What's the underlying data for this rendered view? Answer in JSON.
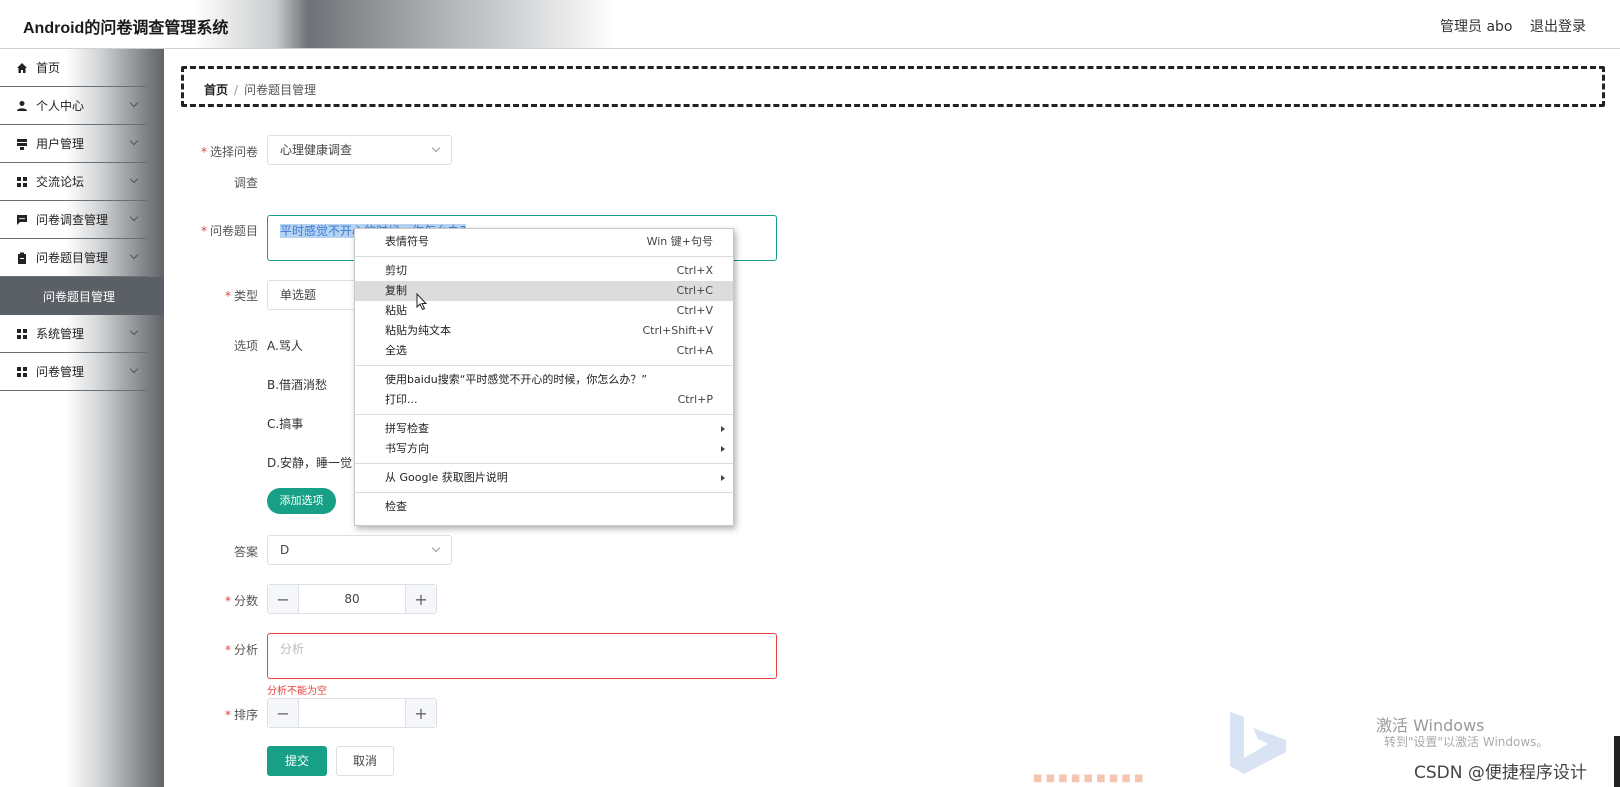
{
  "header": {
    "title": "Android的问卷调查管理系统",
    "user": "管理员 abo",
    "logout": "退出登录"
  },
  "sidebar": {
    "items": [
      {
        "label": "首页",
        "icon": "home-icon"
      },
      {
        "label": "个人中心",
        "icon": "user-icon"
      },
      {
        "label": "用户管理",
        "icon": "users-icon"
      },
      {
        "label": "交流论坛",
        "icon": "grid-icon"
      },
      {
        "label": "问卷调查管理",
        "icon": "chat-icon"
      },
      {
        "label": "问卷题目管理",
        "icon": "clipboard-icon"
      },
      {
        "label": "问卷题目管理"
      },
      {
        "label": "系统管理",
        "icon": "grid-icon"
      },
      {
        "label": "问卷管理",
        "icon": "grid-icon"
      }
    ]
  },
  "breadcrumb": {
    "home": "首页",
    "sep": "/",
    "current": "问卷题目管理"
  },
  "form": {
    "survey_label_1": "选择问卷",
    "survey_label_2": "调查",
    "survey_value": "心理健康调查",
    "question_label": "问卷题目",
    "question_value": "平时感觉不开心的时候，你怎么办?",
    "type_label": "类型",
    "type_value": "单选题",
    "options_label": "选项",
    "options": [
      "A.骂人",
      "B.借酒消愁",
      "C.搞事",
      "D.安静，睡一觉"
    ],
    "add_option": "添加选项",
    "answer_label": "答案",
    "answer_value": "D",
    "score_label": "分数",
    "score_value": "80",
    "analysis_label": "分析",
    "analysis_placeholder": "分析",
    "analysis_error": "分析不能为空",
    "order_label": "排序",
    "order_value": "",
    "submit": "提交",
    "cancel": "取消"
  },
  "context_menu": {
    "emoji": {
      "label": "表情符号",
      "shortcut": "Win 键+句号"
    },
    "cut": {
      "label": "剪切",
      "shortcut": "Ctrl+X"
    },
    "copy": {
      "label": "复制",
      "shortcut": "Ctrl+C"
    },
    "paste": {
      "label": "粘贴",
      "shortcut": "Ctrl+V"
    },
    "paste_plain": {
      "label": "粘贴为纯文本",
      "shortcut": "Ctrl+Shift+V"
    },
    "select_all": {
      "label": "全选",
      "shortcut": "Ctrl+A"
    },
    "search": {
      "label": "使用baidu搜索“平时感觉不开心的时候，你怎么办？”"
    },
    "print": {
      "label": "打印...",
      "shortcut": "Ctrl+P"
    },
    "spellcheck": {
      "label": "拼写检查"
    },
    "writing_direction": {
      "label": "书写方向"
    },
    "google_image": {
      "label": "从 Google 获取图片说明"
    },
    "inspect": {
      "label": "检查"
    }
  },
  "watermark": {
    "line1": "激活 Windows",
    "line2": "转到\"设置\"以激活 Windows。",
    "csdn": "CSDN @便捷程序设计"
  }
}
